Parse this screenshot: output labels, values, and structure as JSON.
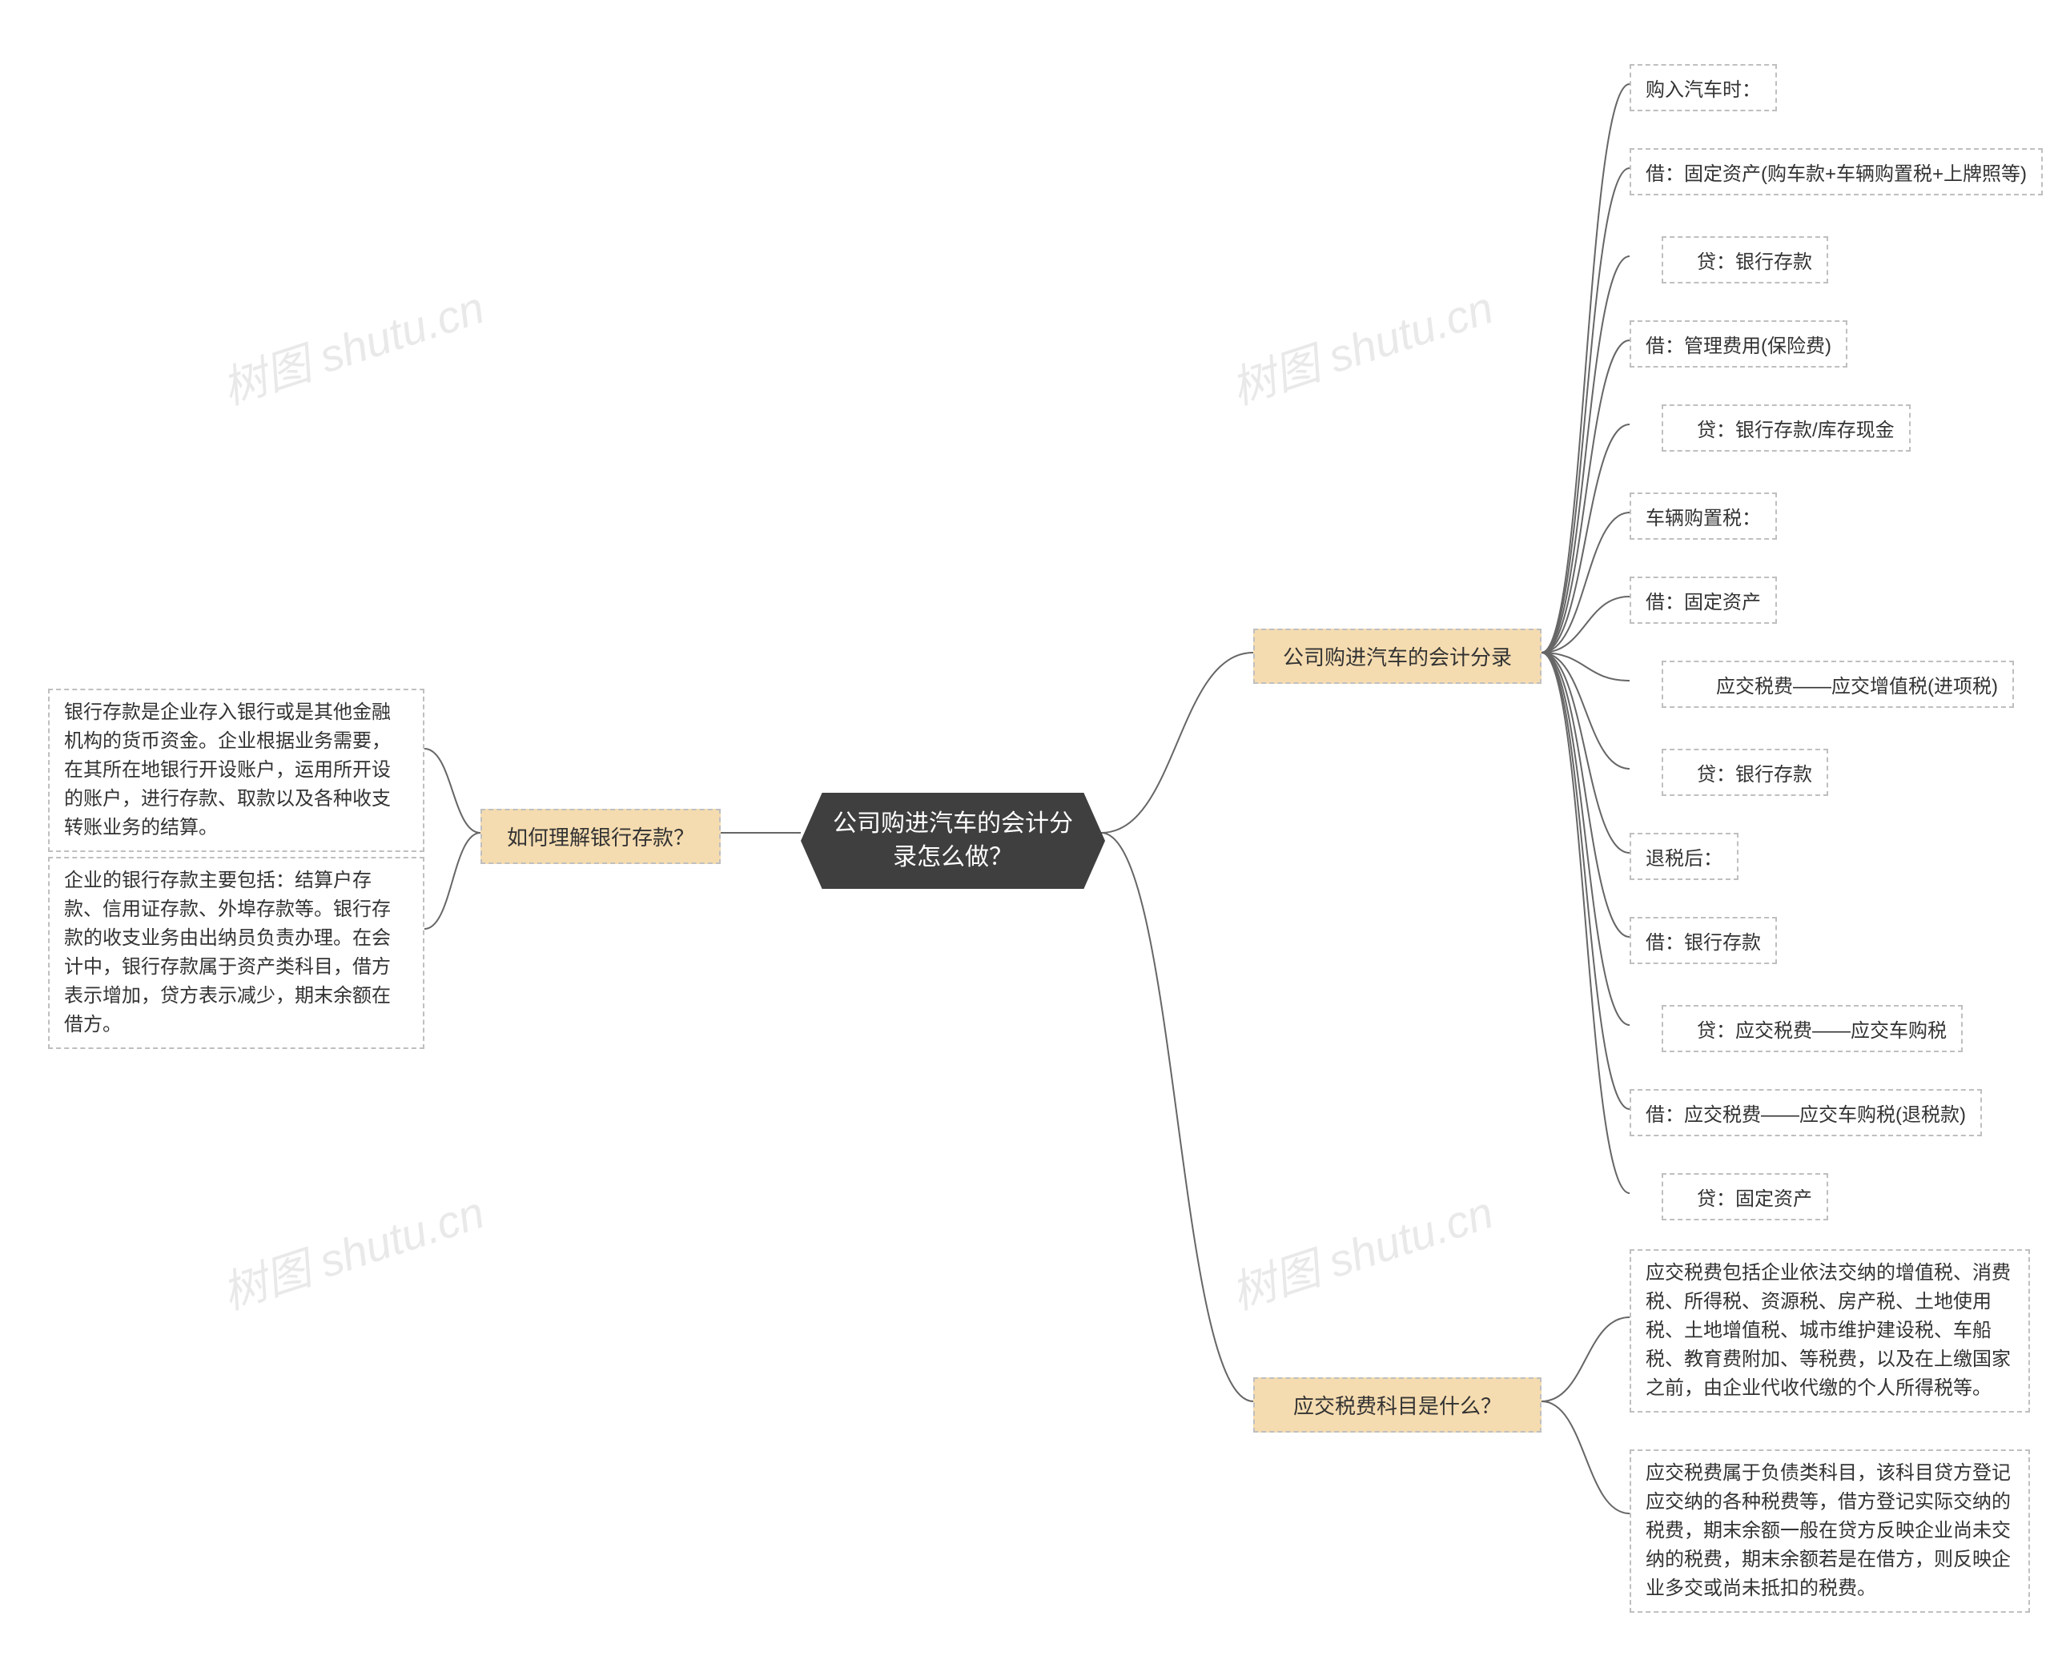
{
  "watermark": "树图 shutu.cn",
  "root": "公司购进汽车的会计分录怎么做？",
  "branches": {
    "b1": "公司购进汽车的会计分录",
    "b2": "应交税费科目是什么？",
    "b3": "如何理解银行存款？"
  },
  "right": {
    "b1_items": [
      "购入汽车时：",
      "借：固定资产(购车款+车辆购置税+上牌照等)",
      "　贷：银行存款",
      "借：管理费用(保险费)",
      "　贷：银行存款/库存现金",
      "车辆购置税：",
      "借：固定资产",
      "　　应交税费——应交增值税(进项税)",
      "　贷：银行存款",
      "退税后：",
      "借：银行存款",
      "　贷：应交税费——应交车购税",
      "借：应交税费——应交车购税(退税款)",
      "　贷：固定资产"
    ],
    "b2_items": [
      "应交税费包括企业依法交纳的增值税、消费税、所得税、资源税、房产税、土地使用税、土地增值税、城市维护建设税、车船税、教育费附加、等税费，以及在上缴国家之前，由企业代收代缴的个人所得税等。",
      "应交税费属于负债类科目，该科目贷方登记应交纳的各种税费等，借方登记实际交纳的税费，期末余额一般在贷方反映企业尚未交纳的税费，期末余额若是在借方，则反映企业多交或尚未抵扣的税费。"
    ]
  },
  "left": {
    "b3_items": [
      "银行存款是企业存入银行或是其他金融机构的货币资金。企业根据业务需要，在其所在地银行开设账户，运用所开设的账户，进行存款、取款以及各种收支转账业务的结算。",
      "企业的银行存款主要包括：结算户存款、信用证存款、外埠存款等。银行存款的收支业务由出纳员负责办理。在会计中，银行存款属于资产类科目，借方表示增加，贷方表示减少，期末余额在借方。"
    ]
  }
}
